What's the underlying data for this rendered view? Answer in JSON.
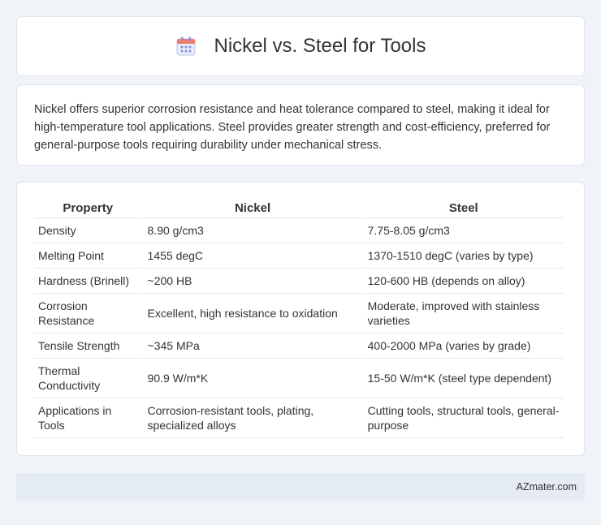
{
  "header": {
    "title": "Nickel vs. Steel for Tools",
    "icon": "calendar-icon",
    "icon_colors": {
      "top": "#f07c6e",
      "body": "#e8ecf8",
      "dots": "#8a8fd6"
    }
  },
  "summary": {
    "text": "Nickel offers superior corrosion resistance and heat tolerance compared to steel, making it ideal for high-temperature tool applications. Steel provides greater strength and cost-efficiency, preferred for general-purpose tools requiring durability under mechanical stress."
  },
  "table": {
    "headers": [
      "Property",
      "Nickel",
      "Steel"
    ],
    "rows": [
      [
        "Density",
        "8.90 g/cm3",
        "7.75-8.05 g/cm3"
      ],
      [
        "Melting Point",
        "1455 degC",
        "1370-1510 degC (varies by type)"
      ],
      [
        "Hardness (Brinell)",
        "~200 HB",
        "120-600 HB (depends on alloy)"
      ],
      [
        "Corrosion Resistance",
        "Excellent, high resistance to oxidation",
        "Moderate, improved with stainless varieties"
      ],
      [
        "Tensile Strength",
        "~345 MPa",
        "400-2000 MPa (varies by grade)"
      ],
      [
        "Thermal Conductivity",
        "90.9 W/m*K",
        "15-50 W/m*K (steel type dependent)"
      ],
      [
        "Applications in Tools",
        "Corrosion-resistant tools, plating, specialized alloys",
        "Cutting tools, structural tools, general-purpose"
      ]
    ]
  },
  "footer": {
    "text": "AZmater.com",
    "background": "#e5ebf5"
  }
}
